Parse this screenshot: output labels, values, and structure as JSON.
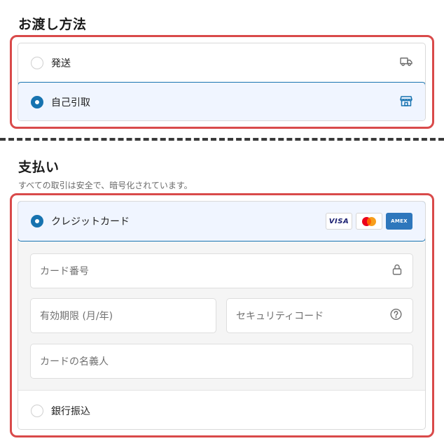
{
  "delivery": {
    "title": "お渡し方法",
    "options": [
      {
        "label": "発送",
        "selected": false,
        "icon": "truck-icon"
      },
      {
        "label": "自己引取",
        "selected": true,
        "icon": "store-icon"
      }
    ]
  },
  "payment": {
    "title": "支払い",
    "subtitle": "すべての取引は安全で、暗号化されています。",
    "credit_card": {
      "label": "クレジットカード",
      "selected": true,
      "brands": [
        "VISA",
        "Mastercard",
        "AMEX"
      ],
      "fields": {
        "number_placeholder": "カード番号",
        "expiry_placeholder": "有効期限 (月/年)",
        "cvv_placeholder": "セキュリティコード",
        "name_placeholder": "カードの名義人"
      }
    },
    "bank_transfer": {
      "label": "銀行振込",
      "selected": false
    }
  },
  "colors": {
    "accent": "#1773b0",
    "selected_bg": "#f0f5ff",
    "highlight_border": "#d94a4a"
  }
}
